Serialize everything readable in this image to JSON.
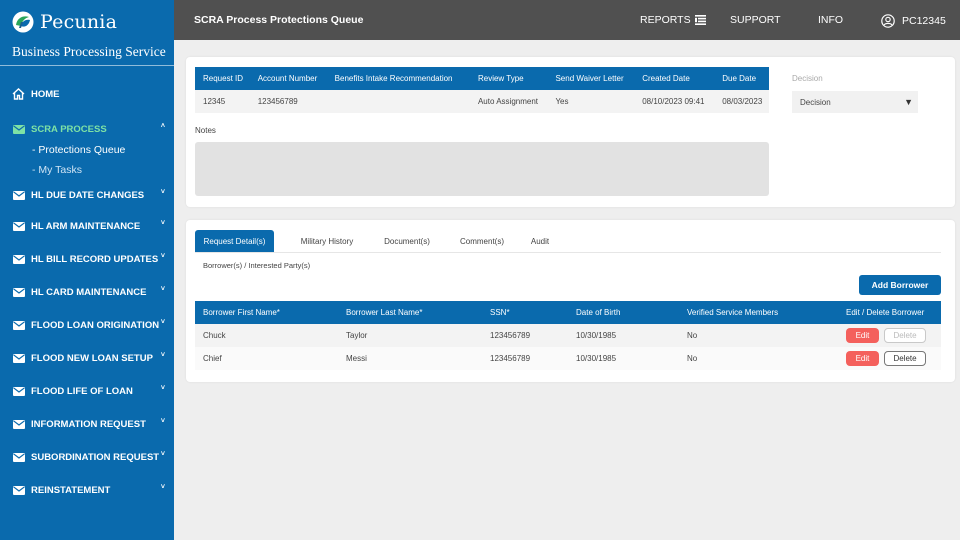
{
  "brand": {
    "name": "Pecunia",
    "subtitle": "Business Processing Service"
  },
  "nav": {
    "home": "HOME",
    "items": [
      {
        "label": "SCRA PROCESS",
        "caret": "˄"
      },
      {
        "label": "HL DUE DATE CHANGES",
        "caret": "˅"
      },
      {
        "label": "HL ARM MAINTENANCE",
        "caret": "˅"
      },
      {
        "label": "HL BILL RECORD UPDATES",
        "caret": "˅"
      },
      {
        "label": "HL CARD MAINTENANCE",
        "caret": "˅"
      },
      {
        "label": "FLOOD LOAN ORIGINATION",
        "caret": "˅"
      },
      {
        "label": "FLOOD NEW LOAN SETUP",
        "caret": "˅"
      },
      {
        "label": "FLOOD LIFE OF LOAN",
        "caret": "˅"
      },
      {
        "label": "INFORMATION REQUEST",
        "caret": "˅"
      },
      {
        "label": "SUBORDINATION REQUEST",
        "caret": "˅"
      },
      {
        "label": "REINSTATEMENT",
        "caret": "˅"
      }
    ],
    "sub": [
      "- Protections Queue",
      "- My Tasks"
    ]
  },
  "topbar": {
    "title": "SCRA Process Protections Queue",
    "reports": "REPORTS",
    "support": "SUPPORT",
    "info": "INFO",
    "user": "PC12345"
  },
  "request": {
    "headers": [
      "Request ID",
      "Account Number",
      "Benefits Intake Recommendation",
      "Review Type",
      "Send Waiver Letter",
      "Created Date",
      "Due Date"
    ],
    "row": [
      "12345",
      "123456789",
      "",
      "Auto Assignment",
      "Yes",
      "08/10/2023 09:41",
      "08/03/2023"
    ]
  },
  "decision": {
    "label": "Decision",
    "value": "Decision"
  },
  "notes": {
    "label": "Notes"
  },
  "tabs": [
    "Request Detail(s)",
    "Military History",
    "Document(s)",
    "Comment(s)",
    "Audit"
  ],
  "borrowers": {
    "section_label": "Borrower(s) / Interested Party(s)",
    "add_label": "Add Borrower",
    "headers": [
      "Borrower First Name*",
      "Borrower Last Name*",
      "SSN*",
      "Date of Birth",
      "Verified Service Members",
      "Edit / Delete Borrower"
    ],
    "rows": [
      [
        "Chuck",
        "Taylor",
        "123456789",
        "10/30/1985",
        "No"
      ],
      [
        "Chief",
        "Messi",
        "123456789",
        "10/30/1985",
        "No"
      ]
    ],
    "edit_label": "Edit",
    "delete_label": "Delete"
  },
  "colors": {
    "primary": "#0a6aad",
    "topbar": "#505050",
    "active_nav": "#7ee2a5",
    "edit": "#f4605c"
  }
}
